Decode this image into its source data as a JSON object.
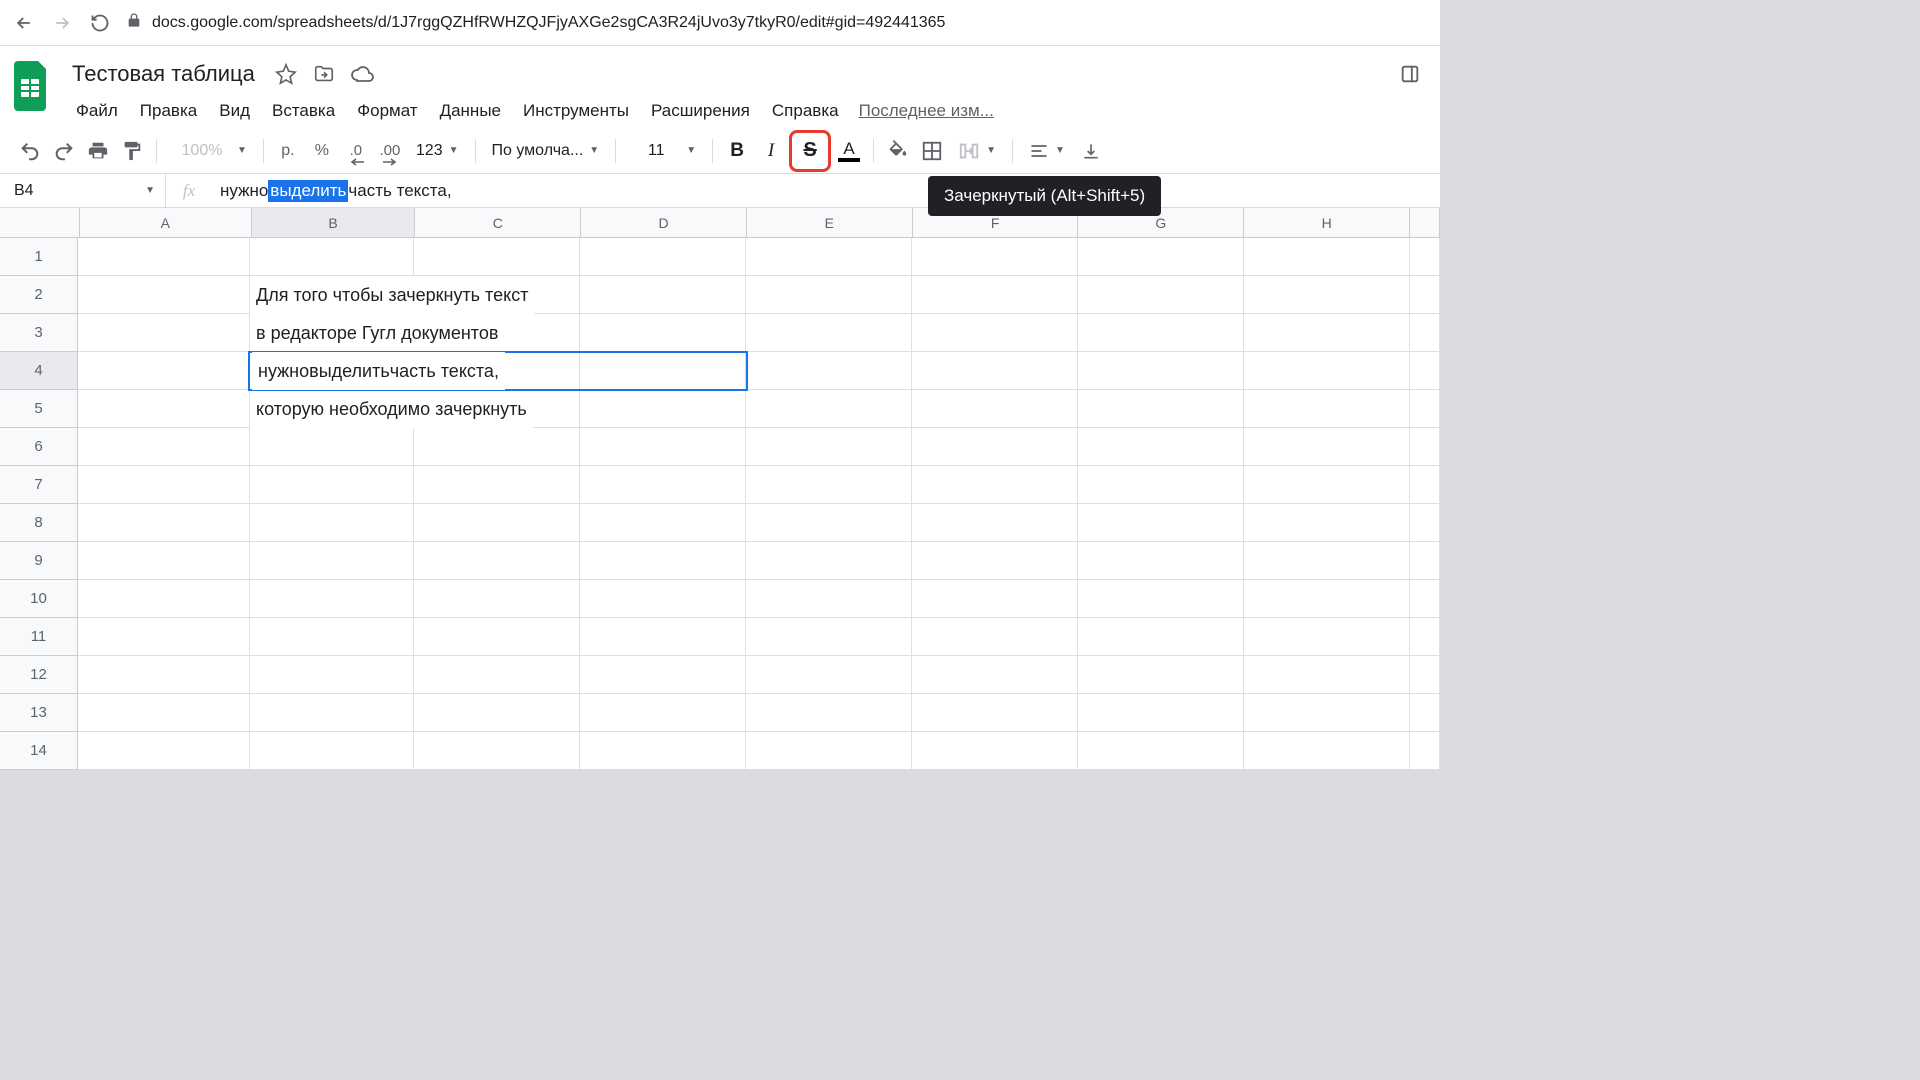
{
  "browser": {
    "url": "docs.google.com/spreadsheets/d/1J7rggQZHfRWHZQJFjyAXGe2sgCA3R24jUvo3y7tkyR0/edit#gid=492441365"
  },
  "doc": {
    "title": "Тестовая таблица"
  },
  "menu": {
    "file": "Файл",
    "edit": "Правка",
    "view": "Вид",
    "insert": "Вставка",
    "format": "Формат",
    "data": "Данные",
    "tools": "Инструменты",
    "extensions": "Расширения",
    "help": "Справка",
    "last_edit": "Последнее изм..."
  },
  "toolbar": {
    "zoom": "100%",
    "currency": "р.",
    "percent": "%",
    "dec_dec": ".0",
    "inc_dec": ".00",
    "more_formats": "123",
    "font": "По умолча...",
    "font_size": "11"
  },
  "tooltip": {
    "strike": "Зачеркнутый (Alt+Shift+5)"
  },
  "formula_bar": {
    "cell_ref": "B4",
    "pre": "нужно ",
    "sel": "выделить",
    "post": " часть текста,"
  },
  "columns": [
    "A",
    "B",
    "C",
    "D",
    "E",
    "F",
    "G",
    "H"
  ],
  "rows": [
    "1",
    "2",
    "3",
    "4",
    "5",
    "6",
    "7",
    "8",
    "9",
    "10",
    "11",
    "12",
    "13",
    "14"
  ],
  "cells": {
    "b2": "Для того чтобы зачеркнуть текст",
    "b3": "в редакторе Гугл документов",
    "b4_pre": "нужно ",
    "b4_strike": "выделить",
    "b4_post": " часть текста,",
    "b5": "которую необходимо зачеркнуть"
  },
  "active": {
    "row": 4,
    "col": "B"
  }
}
